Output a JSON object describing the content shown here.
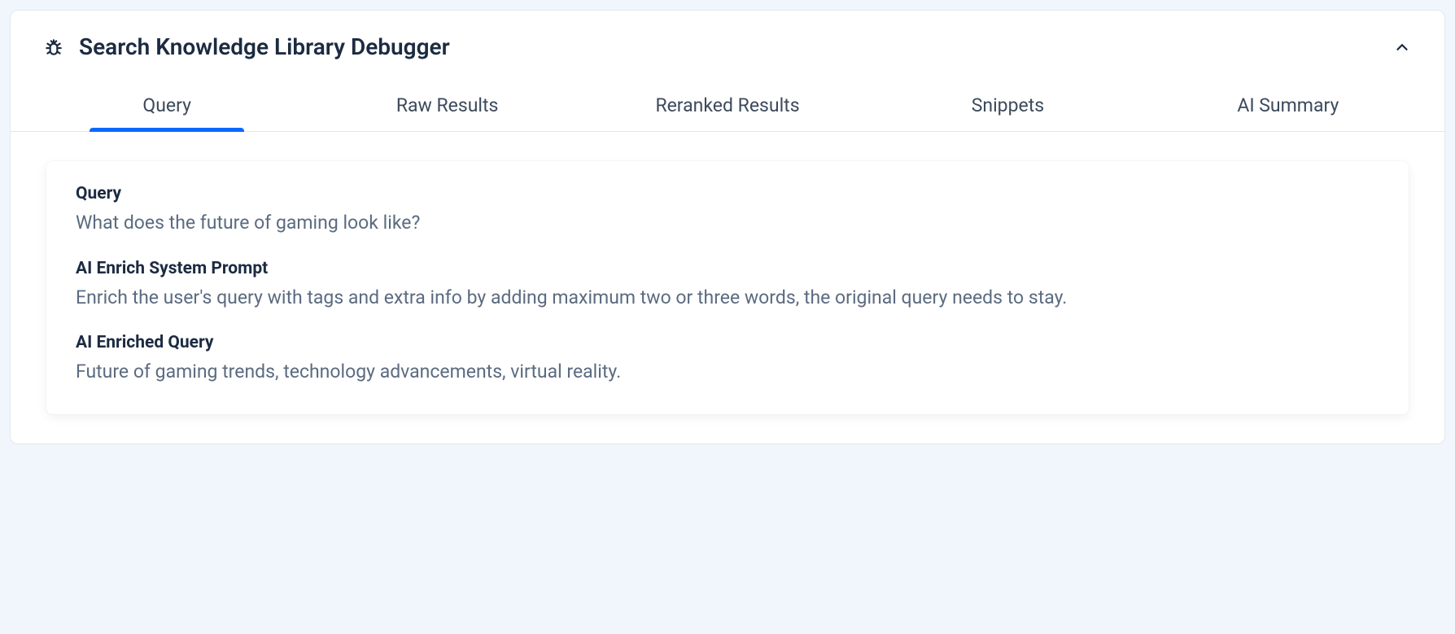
{
  "header": {
    "title": "Search Knowledge Library Debugger"
  },
  "tabs": [
    {
      "label": "Query",
      "active": true
    },
    {
      "label": "Raw Results",
      "active": false
    },
    {
      "label": "Reranked Results",
      "active": false
    },
    {
      "label": "Snippets",
      "active": false
    },
    {
      "label": "AI Summary",
      "active": false
    }
  ],
  "panel": {
    "fields": [
      {
        "label": "Query",
        "value": "What does the future of gaming look like?"
      },
      {
        "label": "AI Enrich System Prompt",
        "value": "Enrich the user's query with tags and extra info by adding maximum two or three words, the original query needs to stay."
      },
      {
        "label": "AI Enriched Query",
        "value": "Future of gaming trends, technology advancements, virtual reality."
      }
    ]
  }
}
